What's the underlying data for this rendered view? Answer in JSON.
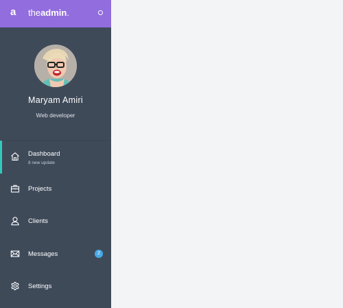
{
  "brand": {
    "mark": "a",
    "name_light": "the",
    "name_bold": "admin",
    "name_suffix": "."
  },
  "profile": {
    "name": "Maryam Amiri",
    "role": "Web developer"
  },
  "nav": [
    {
      "label": "Dashboard",
      "sub": "8 new update",
      "icon": "home-icon",
      "active": true
    },
    {
      "label": "Projects",
      "icon": "briefcase-icon"
    },
    {
      "label": "Clients",
      "icon": "user-icon"
    },
    {
      "label": "Messages",
      "icon": "envelope-icon",
      "badge": "2"
    },
    {
      "label": "Settings",
      "icon": "gear-icon"
    }
  ],
  "colors": {
    "sidebar": "#3f4a59",
    "topbar": "#926dde",
    "accent": "#33cabb",
    "badge": "#48a9e6",
    "content": "#f3f4f6"
  }
}
